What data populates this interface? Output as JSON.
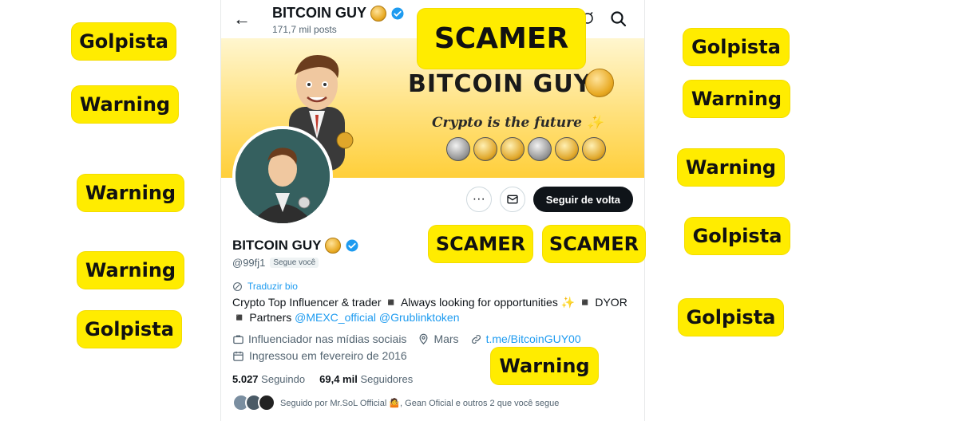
{
  "header": {
    "title": "BITCOIN GUY",
    "posts_count": "171,7 mil posts"
  },
  "banner": {
    "title": "BITCOIN GUY",
    "tagline": "Crypto is the future",
    "sparkle": "✨"
  },
  "actions": {
    "more_label": "···",
    "follow_back_label": "Seguir de volta"
  },
  "profile": {
    "display_name": "BITCOIN GUY",
    "handle": "@99fj1",
    "follows_you": "Segue você",
    "translate_bio": "Traduzir bio",
    "bio_text": "Crypto Top Influencer & trader ◾ Always looking for opportunities ✨ ◾ DYOR ◾ Partners",
    "bio_link1": "@MEXC_official",
    "bio_link2": "@Grublinktoken",
    "category": "Influenciador nas mídias sociais",
    "location": "Mars",
    "website": "t.me/BitcoinGUY00",
    "joined": "Ingressou em fevereiro de 2016",
    "following_count": "5.027",
    "following_label": "Seguindo",
    "followers_count": "69,4 mil",
    "followers_label": "Seguidores",
    "followed_by": "Seguido por Mr.SoL Official 🤷, Gean Oficial e outros 2 que você segue"
  },
  "annotations": {
    "golpista": "Golpista",
    "warning": "Warning",
    "scamer": "SCAMER"
  },
  "colors": {
    "tag_yellow": "#ffec00",
    "link_blue": "#1d9bf0",
    "verified_blue": "#1d9bf0"
  }
}
